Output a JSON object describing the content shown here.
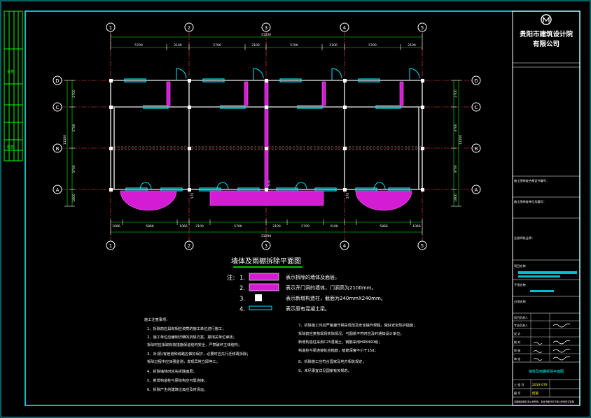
{
  "title_block": {
    "company_line1": "贵阳市建筑设计院",
    "company_line2": "有限公司",
    "review_labels": [
      "施工图审查合格证书编号：",
      "施工图审查单位及编号：",
      "注册师执业章："
    ],
    "project_name_label": "项目名称",
    "sub_project_label": "子项名称",
    "sheet_section_label": "分项名称",
    "role_rows": [
      {
        "role": "项目负责人",
        "person": ""
      },
      {
        "role": "专业负责人",
        "person": ""
      },
      {
        "role": "设    计",
        "person": ""
      },
      {
        "role": "校    对",
        "person": ""
      },
      {
        "role": "审    核",
        "person": ""
      },
      {
        "role": "审    定",
        "person": ""
      }
    ],
    "drawing_title": "墙体及雨棚拆除平面图",
    "project_no_label": "工 程 号",
    "project_no": "2019-079",
    "drawing_no_label": "图    号",
    "drawing_no": "结施",
    "footer_note": "本图纸版权归本公司所有，未经书面许可不得以任何形式复制"
  },
  "left_strip_labels": [
    "会签",
    "图签"
  ],
  "axes": {
    "columns": [
      "1",
      "2",
      "3",
      "4",
      "5"
    ],
    "rows": [
      "D",
      "C",
      "B",
      "A"
    ]
  },
  "dims": {
    "top_total": "31200",
    "top_segments": [
      "5700",
      "2100",
      "5700",
      "2100",
      "5700",
      "2100",
      "5700",
      "2100"
    ],
    "bottom_segments": [
      "1066",
      "5866",
      "1066",
      "2100",
      "5700",
      "2100",
      "5700",
      "2100",
      "5866",
      "1066"
    ],
    "bottom_total": "31200",
    "left_segments": [
      "2700",
      "3700",
      "3700",
      "1800"
    ],
    "left_total": "11100",
    "right_segments": [
      "2700",
      "3700",
      "3700",
      "1800"
    ],
    "right_total": "11100",
    "local_570": "570"
  },
  "drawing_title": "墙体及雨棚拆除平面图",
  "legend": {
    "prefix": "注:",
    "items": [
      {
        "num": "1.",
        "text": "表示拆除的墙体及面层。"
      },
      {
        "num": "2.",
        "text": "表示开门洞的墙体，门洞高为2100mm。"
      },
      {
        "num": "3.",
        "text": "表示新增构造柱，截面为240mmX240mm。"
      },
      {
        "num": "4.",
        "text": "表示原有混凝土梁。"
      }
    ]
  },
  "notes": {
    "heading": "施工注意事项：",
    "left": [
      "1、拆除前应具有相应资质的施工单位进行施工；",
      "2、施工单位应编制详细的拆除方案，报相关单位审核；",
      "   拆除时应采取有效措施保证结构安全，严禁破坏主体结构；",
      "3、对(原)有管道和线路应做好保护，必要时应先行迁移再拆除；",
      "   拆除过程中应加强监测，发现异常立即停工；",
      "4、拆除墙体时应先拆除面层；",
      "5、新增构造柱与原结构应可靠连接；",
      "6、拆除产生的建筑垃圾应及时清运。"
    ],
    "right": [
      "7、拆除施工时应严格遵守相关规范及安全操作规程，做好安全防护措施；",
      "   拆除前应复核现场实际情况，与图纸不符时应及时通知设计单位；",
      "   新增构造柱采用C25混凝土，钢筋采用HRB400级；",
      "   构造柱与梁连接处应植筋，植筋深度不小于15d；",
      "8、拆除施工应符合国家及地方相关规定；",
      "9、未尽事宜详见国家有关规范。"
    ]
  }
}
